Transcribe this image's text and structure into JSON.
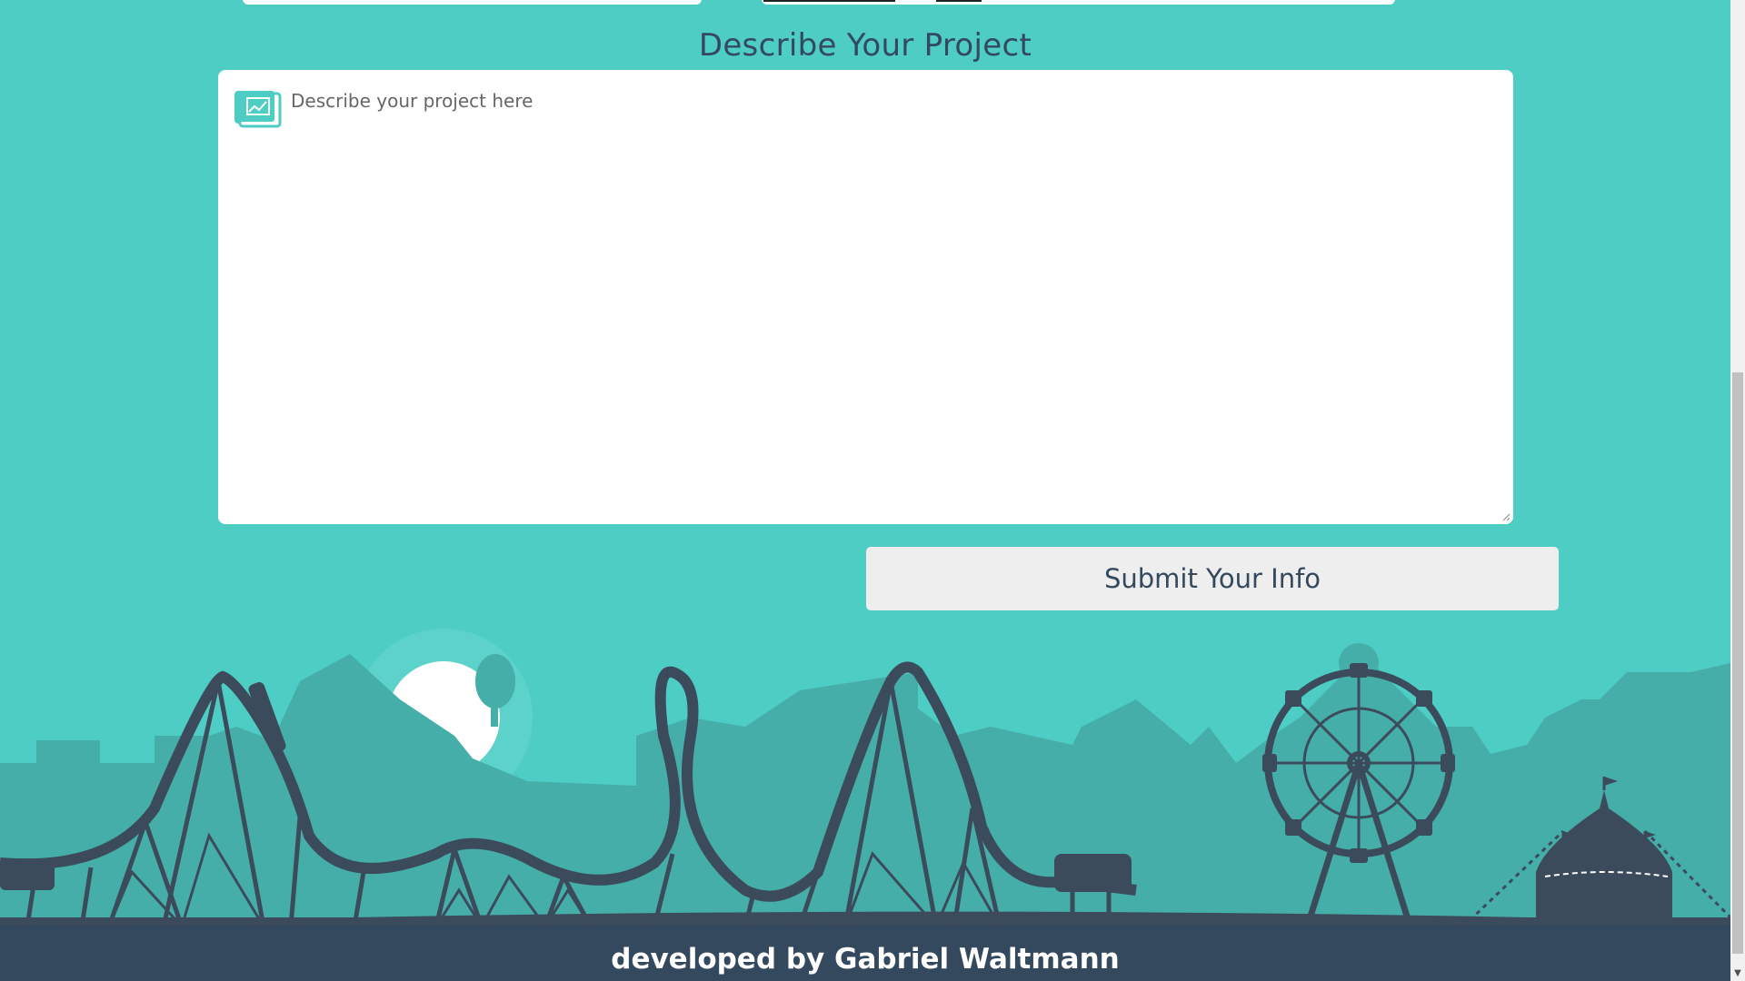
{
  "form": {
    "project_heading": "Describe Your Project",
    "project_placeholder": "Describe your project here",
    "project_icon": "blueprint-chart-icon",
    "submit_label": "Submit Your Info"
  },
  "footer": {
    "credit": "developed by Gabriel Waltmann"
  },
  "colors": {
    "background": "#4ecdc4",
    "heading": "#34495e",
    "footer_bg": "#34495e",
    "skyline_dark": "#3c4b5c",
    "skyline_mid": "#45aea9",
    "button_bg": "#eeeeee"
  }
}
